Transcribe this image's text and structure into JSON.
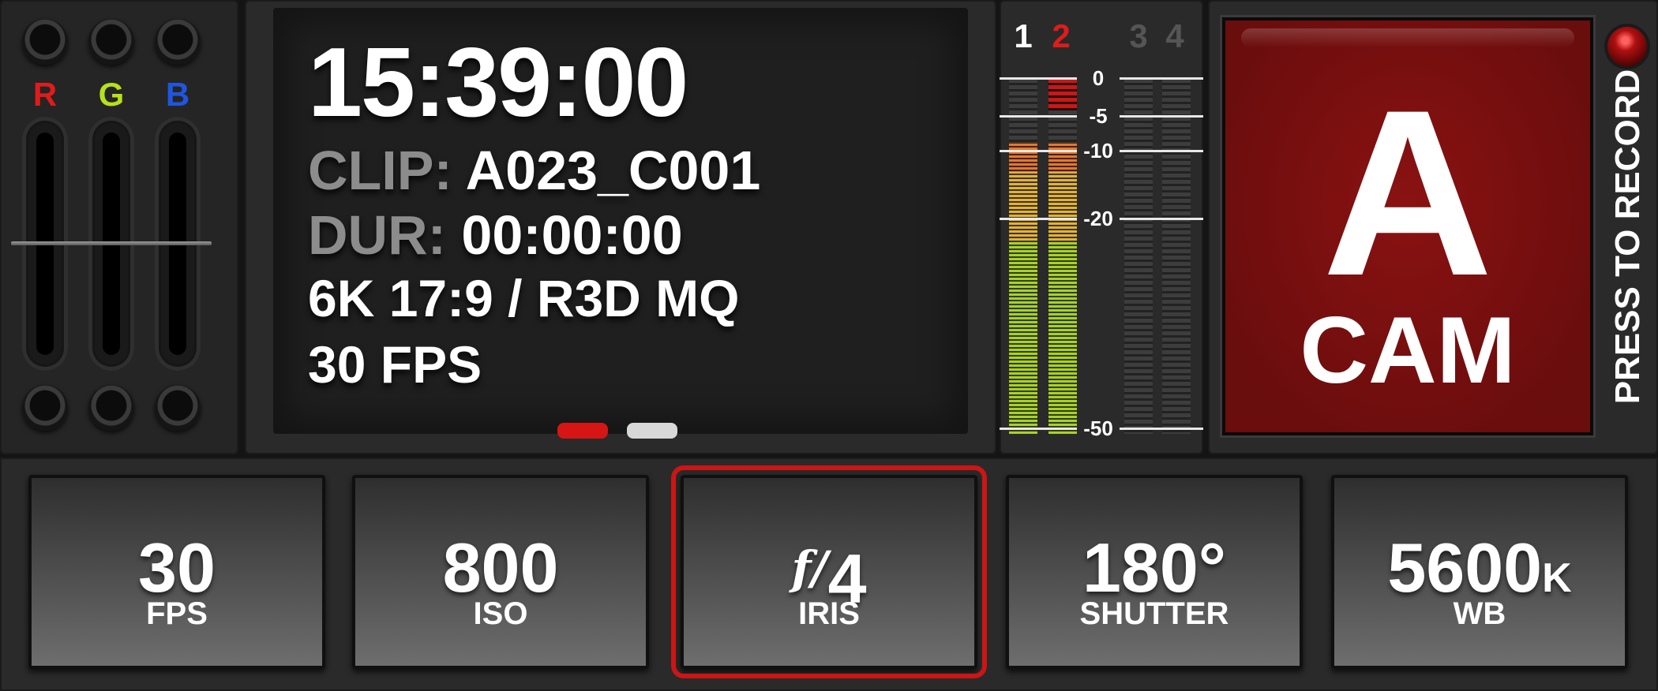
{
  "rgb": {
    "letters": {
      "r": "R",
      "g": "G",
      "b": "B"
    },
    "colors": {
      "r": "#e01b1b",
      "g": "#b7e11a",
      "b": "#1f56e0"
    }
  },
  "info": {
    "timecode": "15:39:00",
    "clip_label": "CLIP:",
    "clip_value": "A023_C001",
    "dur_label": "DUR:",
    "dur_value": "00:00:00",
    "format": "6K 17:9 / R3D MQ",
    "fps": "30 FPS",
    "pages": {
      "active": 1,
      "count": 2
    }
  },
  "audio": {
    "channels": [
      {
        "label": "1",
        "color": "#ffffff"
      },
      {
        "label": "2",
        "color": "#e01b1b"
      },
      {
        "label": "3",
        "color": "#555555"
      },
      {
        "label": "4",
        "color": "#555555"
      }
    ],
    "scale": [
      "0",
      "-5",
      "-10",
      "-20",
      "-50"
    ],
    "levels": {
      "ch1": 0.9,
      "ch2": 0.9,
      "ch2_peak": true
    }
  },
  "record": {
    "letter": "A",
    "word": "CAM",
    "press_label": "PRESS TO RECORD",
    "accent": "#7a0f0f"
  },
  "params": [
    {
      "value": "30",
      "unit": "",
      "label": "FPS",
      "active": false
    },
    {
      "value": "800",
      "unit": "",
      "label": "ISO",
      "active": false
    },
    {
      "value": "4",
      "prefix": "f/",
      "unit": "",
      "label": "IRIS",
      "active": true
    },
    {
      "value": "180°",
      "unit": "",
      "label": "SHUTTER",
      "active": false
    },
    {
      "value": "5600",
      "unit": "K",
      "label": "WB",
      "active": false
    }
  ]
}
